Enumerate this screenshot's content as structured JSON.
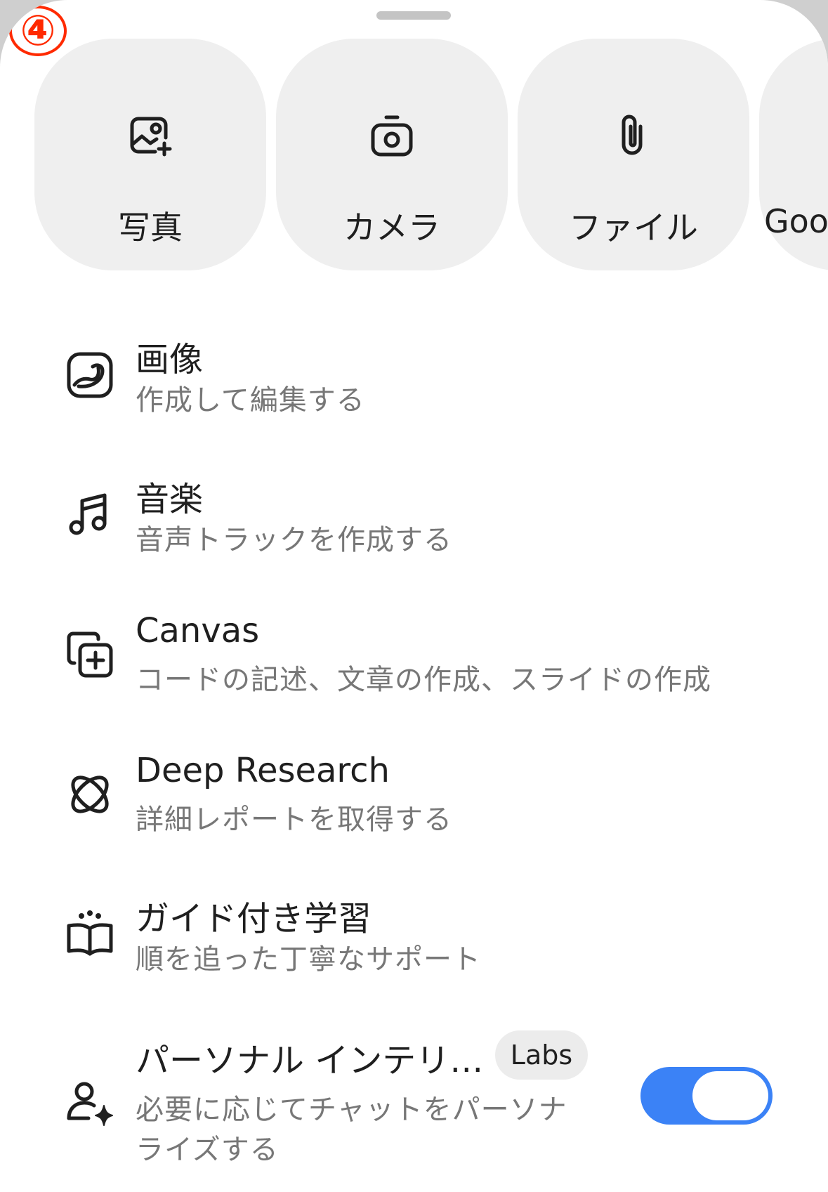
{
  "step_marker": "④",
  "tiles": [
    {
      "label": "写真",
      "icon": "photo-add-icon"
    },
    {
      "label": "カメラ",
      "icon": "camera-icon"
    },
    {
      "label": "ファイル",
      "icon": "paperclip-icon"
    },
    {
      "label": "Goo",
      "icon": "none"
    }
  ],
  "tools": [
    {
      "title": "画像",
      "subtitle": "作成して編集する",
      "icon": "image-create-icon"
    },
    {
      "title": "音楽",
      "subtitle": "音声トラックを作成する",
      "icon": "music-note-icon"
    },
    {
      "title": "Canvas",
      "subtitle": "コードの記述、文章の作成、スライドの作成",
      "icon": "canvas-add-icon"
    },
    {
      "title": "Deep Research",
      "subtitle": "詳細レポートを取得する",
      "icon": "deep-research-icon"
    },
    {
      "title": "ガイド付き学習",
      "subtitle": "順を追った丁寧なサポート",
      "icon": "open-book-icon"
    },
    {
      "title": "パーソナル インテリ…",
      "subtitle_line1": "必要に応じてチャットをパーソナ",
      "subtitle_line2": "ライズする",
      "badge": "Labs",
      "icon": "person-sparkle-icon",
      "toggle_on": true
    }
  ],
  "colors": {
    "accent": "#3b82f6",
    "tile_bg": "#efefef",
    "marker": "#ff2a00"
  }
}
